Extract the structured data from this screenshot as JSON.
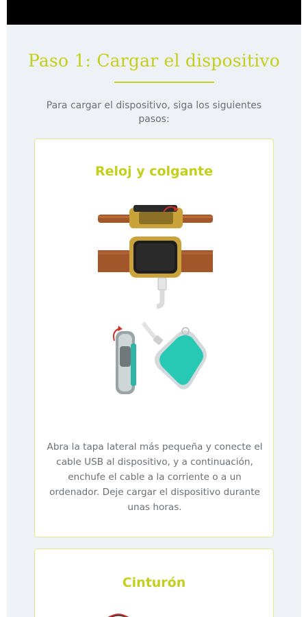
{
  "title": "Paso 1: Cargar el dispositivo",
  "intro": "Para cargar el dispositivo, siga los siguientes pasos:",
  "cards": [
    {
      "title": "Reloj y colgante",
      "text": "Abra la tapa lateral más pequeña y conecte el cable USB al dispositivo, y a continuación, enchufe el cable a la corriente o a un ordenador. Deje cargar el dispositivo durante unas horas."
    },
    {
      "title": "Cinturón"
    }
  ],
  "colors": {
    "accent": "#c3cf1f",
    "background": "#eef1f5",
    "text": "#6b6f73"
  }
}
